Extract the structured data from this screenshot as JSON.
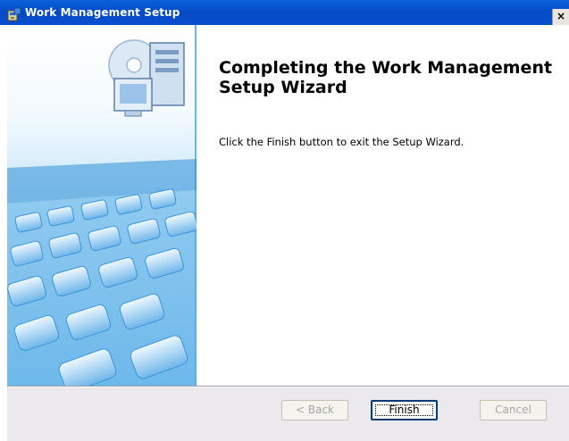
{
  "window": {
    "title": "Work Management Setup",
    "close_glyph": "×"
  },
  "main": {
    "heading": "Completing the Work Management Setup Wizard",
    "body": "Click the Finish button to exit the Setup Wizard."
  },
  "buttons": {
    "back": "< Back",
    "finish": "Finish",
    "cancel": "Cancel"
  },
  "colors": {
    "titlebar": "#0a58d8",
    "sidebar_accent": "#3aa0e0",
    "footer": "#ebe9ed"
  },
  "icons": [
    "installer-icon",
    "computer-cd-icon",
    "keyboard-image"
  ]
}
